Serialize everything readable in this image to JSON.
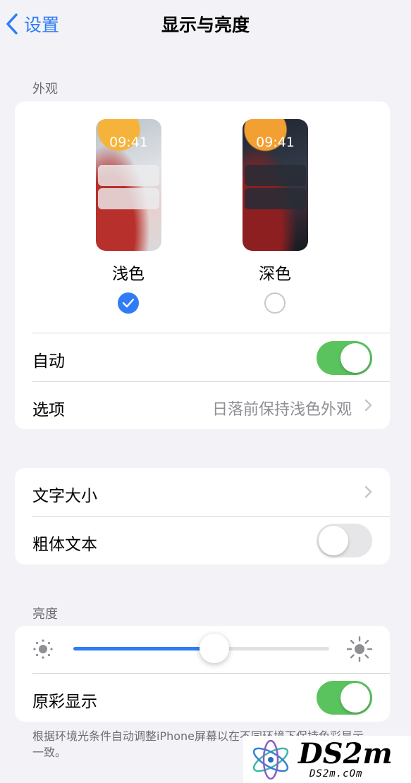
{
  "nav": {
    "back_label": "设置",
    "title": "显示与亮度"
  },
  "appearance": {
    "header": "外观",
    "light": {
      "time": "09:41",
      "label": "浅色",
      "selected": true
    },
    "dark": {
      "time": "09:41",
      "label": "深色",
      "selected": false
    },
    "auto": {
      "label": "自动",
      "on": true
    },
    "options": {
      "label": "选项",
      "value": "日落前保持浅色外观"
    }
  },
  "text": {
    "size": {
      "label": "文字大小"
    },
    "bold": {
      "label": "粗体文本",
      "on": false
    }
  },
  "brightness": {
    "header": "亮度",
    "level": 0.55,
    "true_tone": {
      "label": "原彩显示",
      "on": true
    },
    "footer": "根据环境光条件自动调整iPhone屏幕以在不同环境下保持色彩显示一致。"
  },
  "watermark": {
    "text": "DS2m",
    "sub": "DS2m.cOm"
  },
  "colors": {
    "accent": "#2f7cf6",
    "toggle_on": "#5ac35d",
    "background": "#f2f2f7"
  }
}
